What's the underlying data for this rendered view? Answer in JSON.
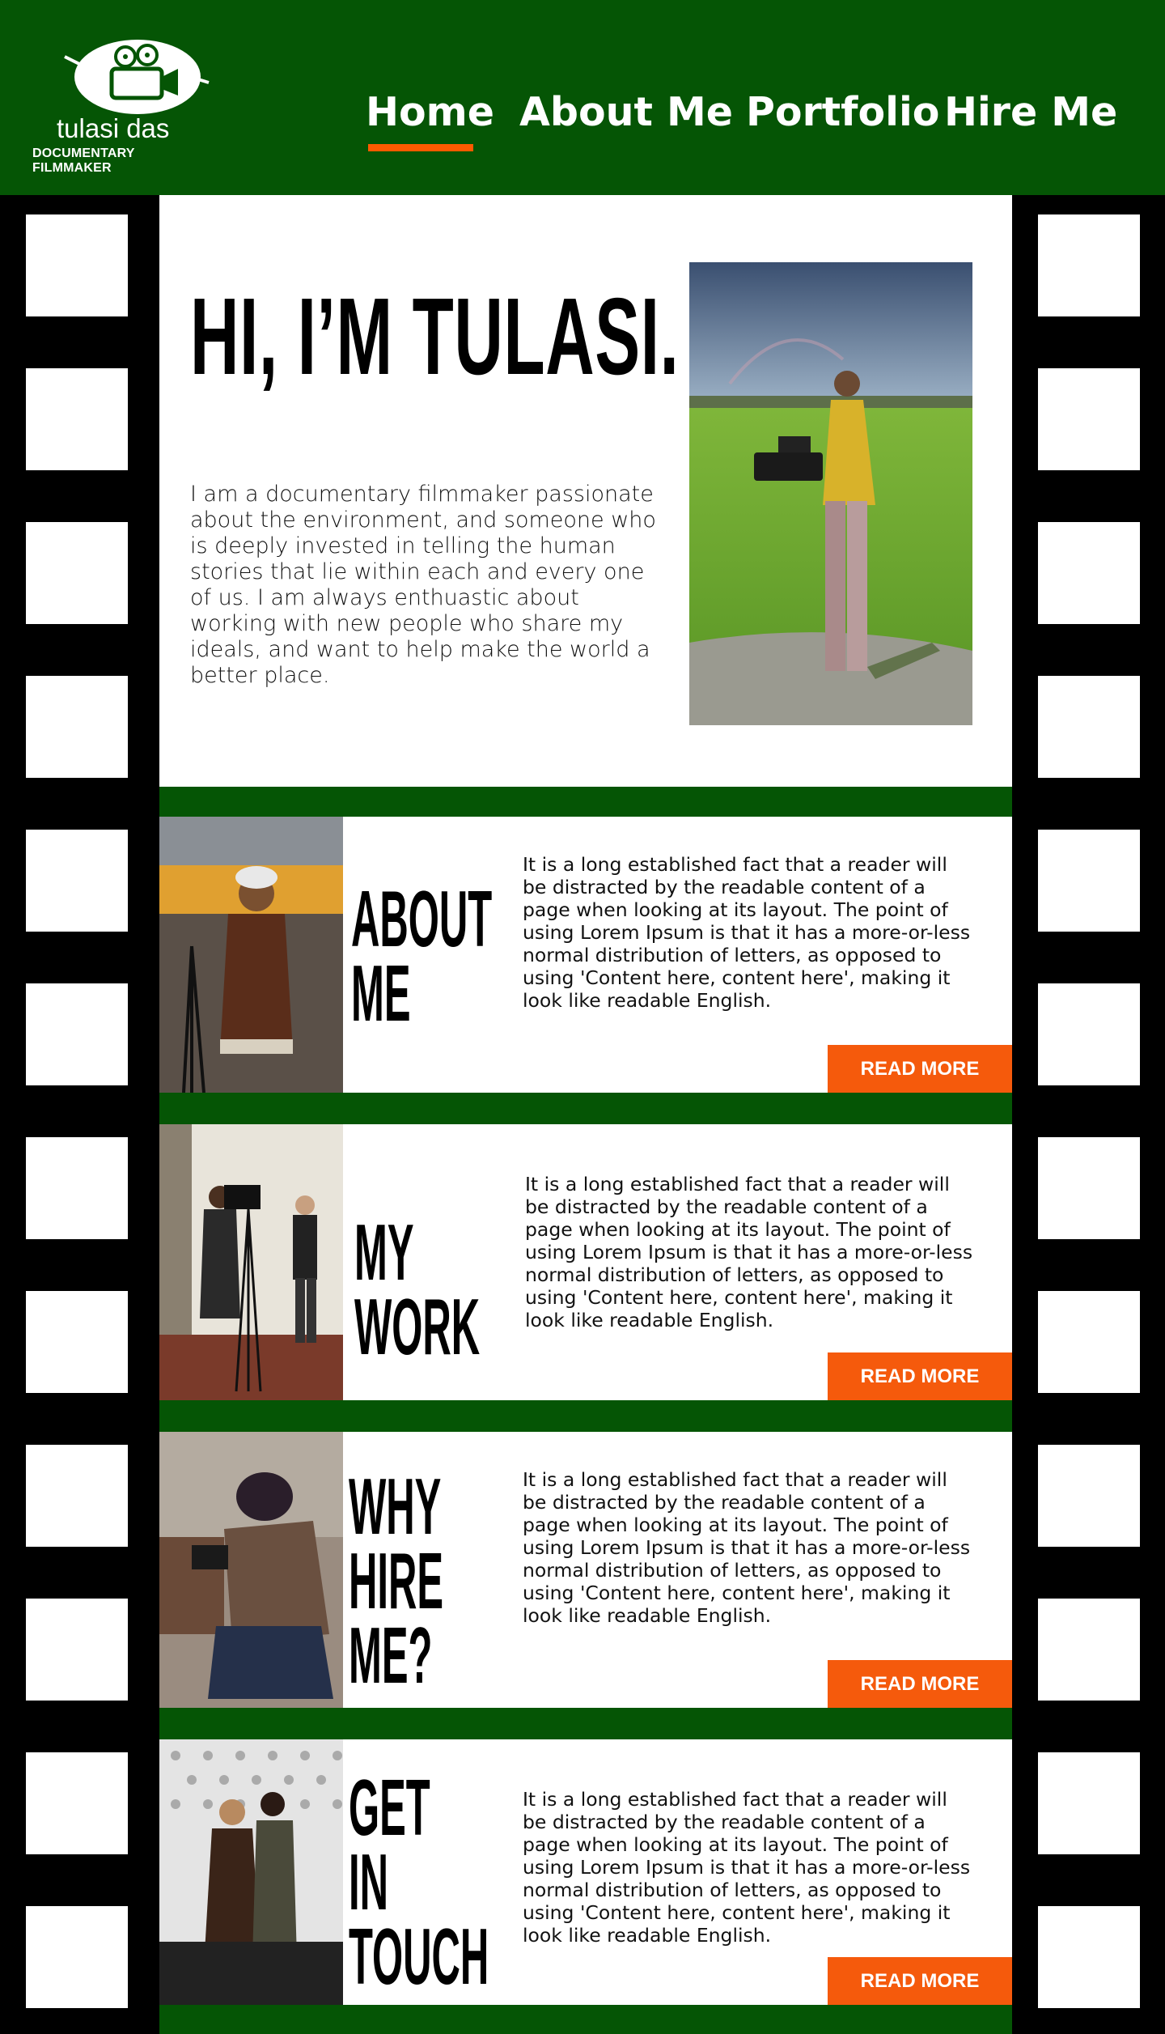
{
  "brand": {
    "name": "tulasi das",
    "tagline": "DOCUMENTARY FILMMAKER"
  },
  "nav": {
    "items": [
      {
        "label": "Home",
        "active": true
      },
      {
        "label": "About Me",
        "active": false
      },
      {
        "label": "Portfolio",
        "active": false
      },
      {
        "label": "Hire Me",
        "active": false
      }
    ]
  },
  "hero": {
    "title": "HI, I’M TULASI.",
    "text": "I am a documentary filmmaker passionate about the environment, and someone who is deeply invested in telling the human stories that lie within each and every one of us. I am always enthuastic about working with new people who share my ideals, and want to help make the world a better place."
  },
  "sections": [
    {
      "heading": "ABOUT\nME",
      "text": "It is a long established fact that a reader will be distracted by the readable content of a page when looking at its layout. The point of using Lorem Ipsum is that it has a more-or-less normal distribution of letters, as opposed to using 'Content here, content here', making it look like readable English.",
      "button": "READ MORE"
    },
    {
      "heading": "MY\nWORK",
      "text": "It is a long established fact that a reader will be distracted by the readable content of a page when looking at its layout. The point of using Lorem Ipsum is that it has a more-or-less normal distribution of letters, as opposed to using 'Content here, content here', making it look like readable English.",
      "button": "READ MORE"
    },
    {
      "heading": "WHY\nHIRE\nME?",
      "text": "It is a long established fact that a reader will be distracted by the readable content of a page when looking at its layout. The point of using Lorem Ipsum is that it has a more-or-less normal distribution of letters, as opposed to using 'Content here, content here', making it look like readable English.",
      "button": "READ MORE"
    },
    {
      "heading": "GET\nIN\nTOUCH",
      "text": "It is a long established fact that a reader will be distracted by the readable content of a page when looking at its layout. The point of using Lorem Ipsum is that it has a more-or-less normal distribution of letters, as opposed to using 'Content here, content here', making it look like readable English.",
      "button": "READ MORE"
    }
  ],
  "colors": {
    "brand_green": "#055505",
    "accent_orange": "#f55a0c",
    "nav_underline": "#ff5a00"
  }
}
